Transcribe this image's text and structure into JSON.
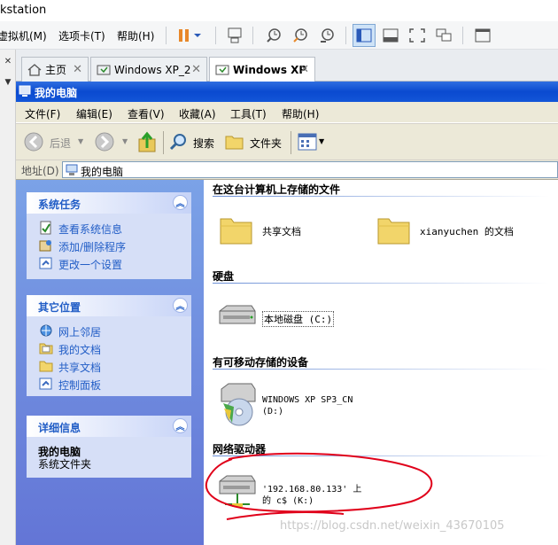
{
  "host": {
    "title": "kstation",
    "menus": [
      "虚拟机(M)",
      "选项卡(T)",
      "帮助(H)"
    ],
    "tabs": [
      {
        "label": "主页",
        "active": false
      },
      {
        "label": "Windows XP_2",
        "active": false
      },
      {
        "label": "Windows XP",
        "active": true
      }
    ]
  },
  "xp": {
    "window_title": "我的电脑",
    "menus": [
      "文件(F)",
      "编辑(E)",
      "查看(V)",
      "收藏(A)",
      "工具(T)",
      "帮助(H)"
    ],
    "toolbar": {
      "back": "后退",
      "search": "搜索",
      "folders": "文件夹"
    },
    "address": {
      "label": "地址(D)",
      "value": "我的电脑"
    },
    "left_panels": [
      {
        "title": "系统任务",
        "items": [
          "查看系统信息",
          "添加/删除程序",
          "更改一个设置"
        ]
      },
      {
        "title": "其它位置",
        "items": [
          "网上邻居",
          "我的文档",
          "共享文档",
          "控制面板"
        ]
      },
      {
        "title": "详细信息",
        "detail_title": "我的电脑",
        "detail_sub": "系统文件夹"
      }
    ],
    "sections": [
      {
        "header": "在这台计算机上存储的文件",
        "items": [
          "共享文档",
          "xianyuchen 的文档"
        ]
      },
      {
        "header": "硬盘",
        "items": [
          "本地磁盘 (C:)"
        ]
      },
      {
        "header": "有可移动存储的设备",
        "items": [
          "WINDOWS XP SP3_CN",
          "(D:)"
        ]
      },
      {
        "header": "网络驱动器",
        "items": [
          "'192.168.80.133' 上",
          "的 c$ (K:)"
        ]
      }
    ]
  },
  "watermark": "https://blog.csdn.net/weixin_43670105",
  "colors": {
    "xp_blue": "#0a4ad0",
    "annotation_red": "#e0001a"
  }
}
